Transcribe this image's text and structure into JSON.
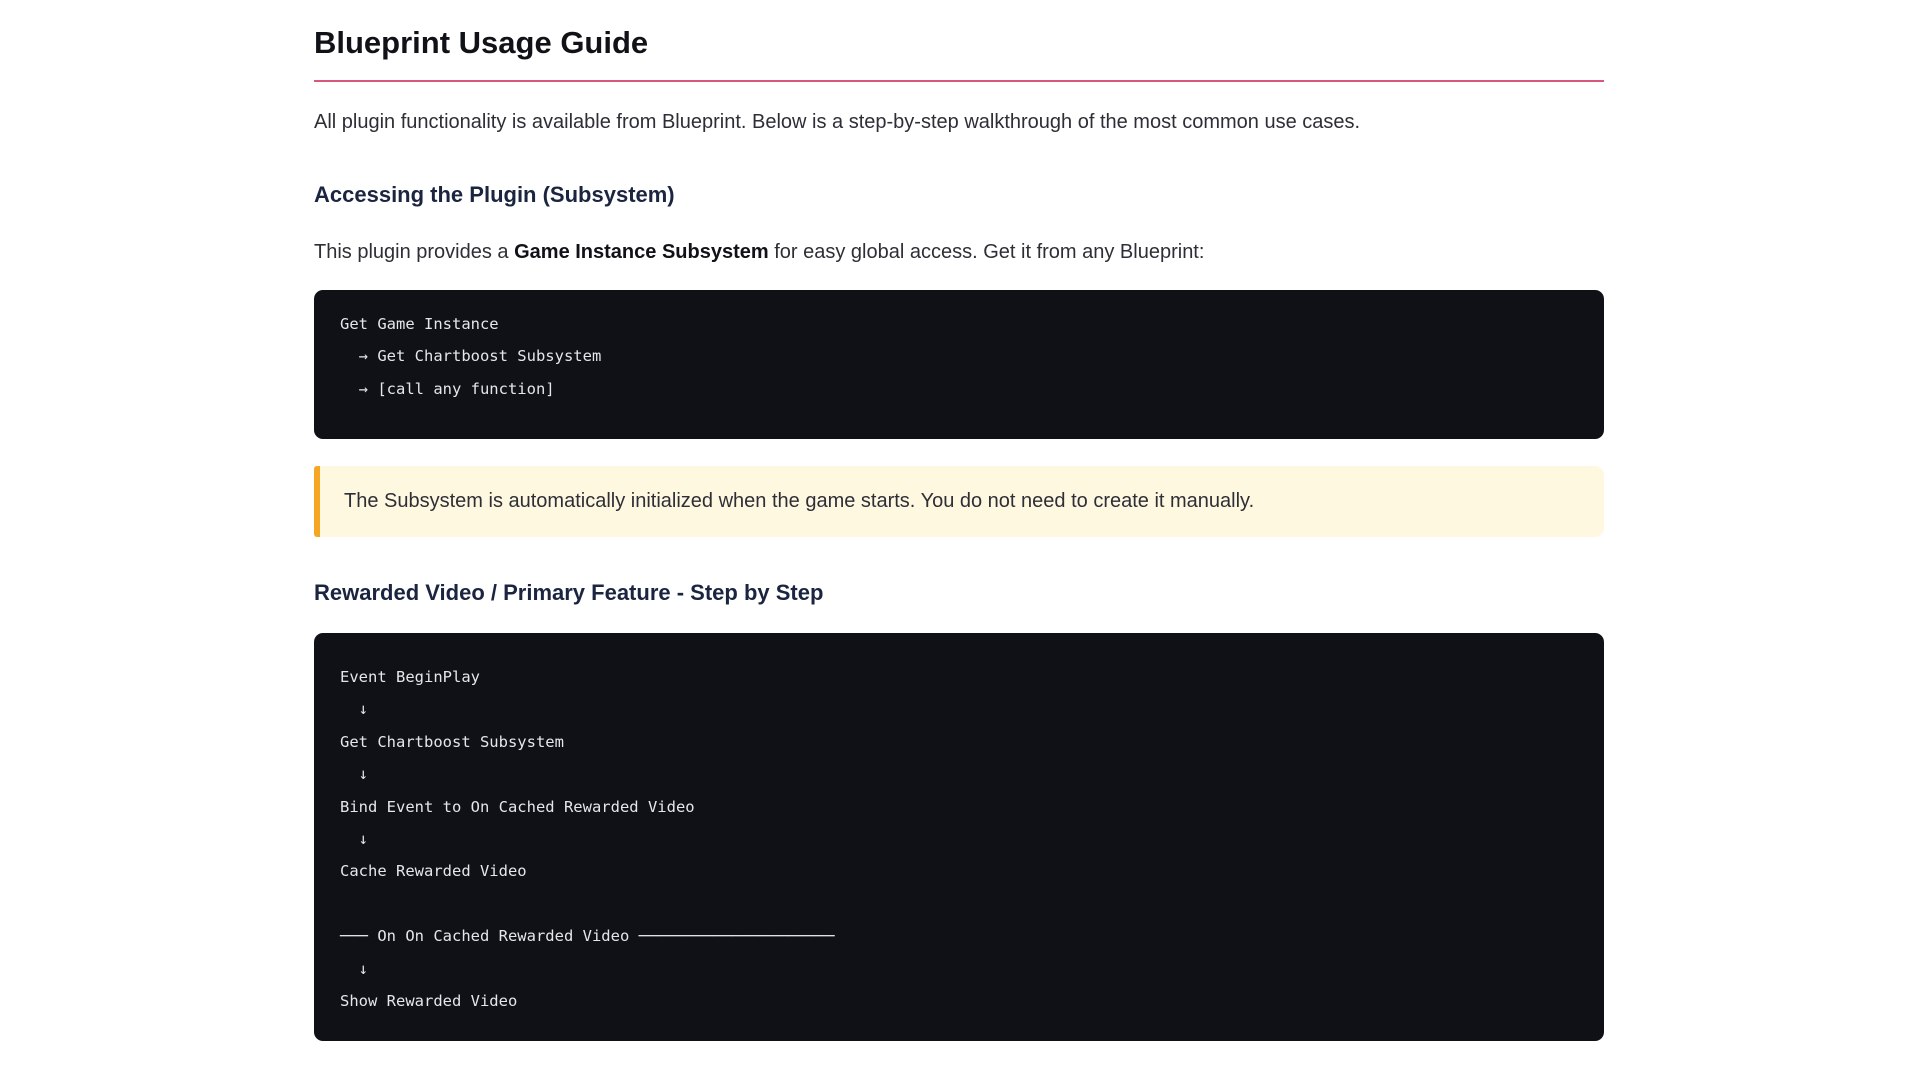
{
  "page": {
    "title": "Blueprint Usage Guide",
    "intro": "All plugin functionality is available from Blueprint. Below is a step-by-step walkthrough of the most common use cases."
  },
  "access_section": {
    "heading": "Accessing the Plugin (Subsystem)",
    "desc_prefix": "This plugin provides a ",
    "desc_bold": "Game Instance Subsystem",
    "desc_suffix": " for easy global access. Get it from any Blueprint:",
    "code_lines": [
      "Get Game Instance",
      "  → Get Chartboost Subsystem",
      "  → [call any function]"
    ]
  },
  "note": {
    "text": "The Subsystem is automatically initialized when the game starts. You do not need to create it manually."
  },
  "reward_section": {
    "heading": "Rewarded Video / Primary Feature - Step by Step",
    "code_lines": [
      "Event BeginPlay",
      "  ↓",
      "Get Chartboost Subsystem",
      "  ↓",
      "Bind Event to On Cached Rewarded Video",
      "  ↓",
      "Cache Rewarded Video",
      "",
      "─── On On Cached Rewarded Video ─────────────────────",
      "  ↓",
      "Show Rewarded Video"
    ]
  },
  "colors": {
    "title_underline": "#d9587a",
    "code_background": "#0f1117",
    "note_background": "#fff8e1",
    "note_border": "#f5a623",
    "heading": "#1b2540"
  }
}
